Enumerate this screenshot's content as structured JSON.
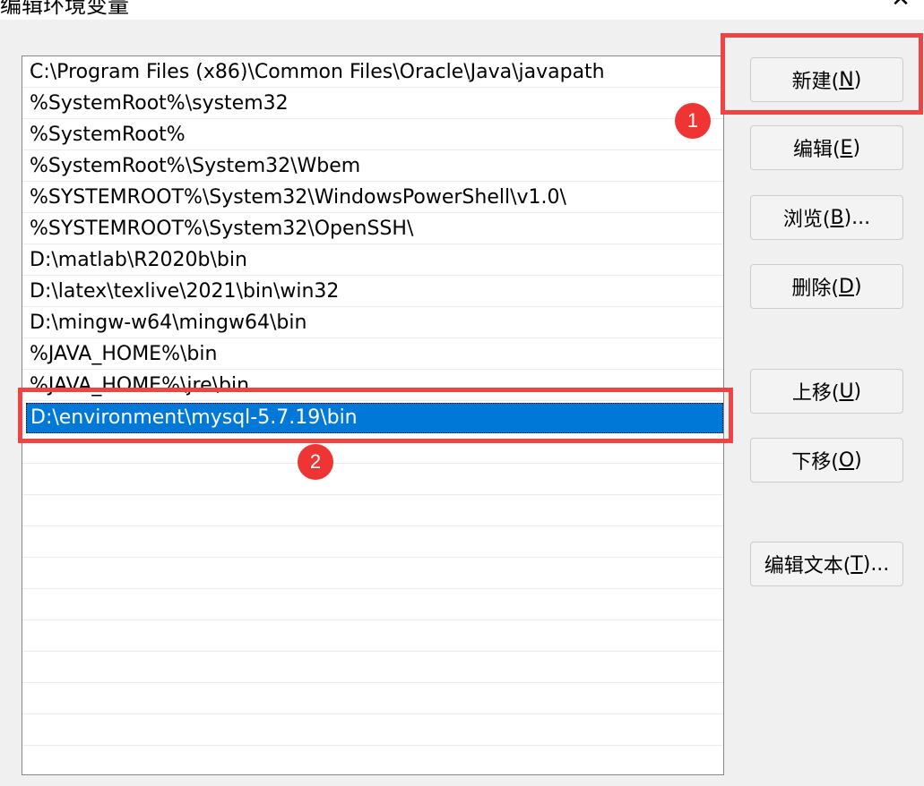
{
  "window": {
    "title": "编辑环境变量",
    "close_glyph": "✕"
  },
  "path_list": {
    "items": [
      "C:\\Program Files (x86)\\Common Files\\Oracle\\Java\\javapath",
      "%SystemRoot%\\system32",
      "%SystemRoot%",
      "%SystemRoot%\\System32\\Wbem",
      "%SYSTEMROOT%\\System32\\WindowsPowerShell\\v1.0\\",
      "%SYSTEMROOT%\\System32\\OpenSSH\\",
      "D:\\matlab\\R2020b\\bin",
      "D:\\latex\\texlive\\2021\\bin\\win32",
      "D:\\mingw-w64\\mingw64\\bin",
      "%JAVA_HOME%\\bin",
      "%JAVA_HOME%\\jre\\bin",
      "D:\\environment\\mysql-5.7.19\\bin"
    ],
    "selected_index": 11
  },
  "buttons": {
    "new": {
      "pre": "新建(",
      "key": "N",
      "post": ")"
    },
    "edit": {
      "pre": "编辑(",
      "key": "E",
      "post": ")"
    },
    "browse": {
      "pre": "浏览(",
      "key": "B",
      "post": ")..."
    },
    "delete": {
      "pre": "删除(",
      "key": "D",
      "post": ")"
    },
    "move_up": {
      "pre": "上移(",
      "key": "U",
      "post": ")"
    },
    "move_down": {
      "pre": "下移(",
      "key": "O",
      "post": ")"
    },
    "edit_text": {
      "pre": "编辑文本(",
      "key": "T",
      "post": ")..."
    }
  },
  "annotations": {
    "badge_1": "1",
    "badge_2": "2",
    "highlight_color": "#ef4444",
    "selection_color": "#0078d7"
  }
}
